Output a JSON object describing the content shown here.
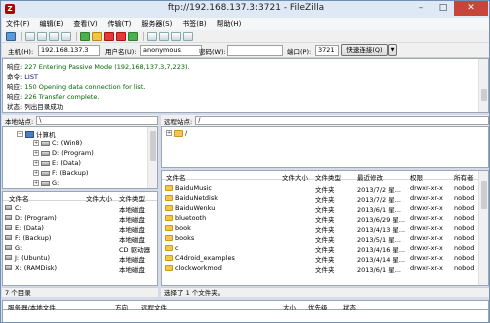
{
  "window": {
    "title": "ftp://192.168.137.3:3721 - FileZilla",
    "app_icon": "filezilla-icon",
    "controls": {
      "minimize": "–",
      "maximize": "□",
      "close": "✕"
    }
  },
  "menu": [
    "文件(F)",
    "编辑(E)",
    "查看(V)",
    "传输(T)",
    "服务器(S)",
    "书签(B)",
    "帮助(H)"
  ],
  "quickconnect": {
    "host_label": "主机(H):",
    "host_value": "192.168.137.3",
    "user_label": "用户名(U):",
    "user_value": "anonymous",
    "pass_label": "密码(W):",
    "pass_value": "",
    "port_label": "端口(P):",
    "port_value": "3721",
    "connect_label": "快速连接(Q)",
    "drop_icon": "▼"
  },
  "log": [
    {
      "key": "响应:",
      "text": "227 Entering Passive Mode (192,168,137,3,7,223).",
      "ok": true
    },
    {
      "key": "命令:",
      "text": "LIST",
      "ok": false
    },
    {
      "key": "响应:",
      "text": "150 Opening data connection for list.",
      "ok": true
    },
    {
      "key": "响应:",
      "text": "226 Transfer complete.",
      "ok": true
    },
    {
      "key": "状态:",
      "text": "列出目录成功",
      "ok": false
    }
  ],
  "local": {
    "site_label": "本地站点:",
    "site_value": "\\",
    "tree": [
      {
        "label": "计算机",
        "level": 0,
        "icon": "computer-icon",
        "expander": "−"
      },
      {
        "label": "C: (Win8)",
        "level": 1,
        "icon": "drive-icon",
        "expander": "+"
      },
      {
        "label": "D: (Program)",
        "level": 1,
        "icon": "drive-icon",
        "expander": "+"
      },
      {
        "label": "E: (Data)",
        "level": 1,
        "icon": "drive-icon",
        "expander": "+"
      },
      {
        "label": "F: (Backup)",
        "level": 1,
        "icon": "drive-icon",
        "expander": "+"
      },
      {
        "label": "G:",
        "level": 1,
        "icon": "drive-icon",
        "expander": "+"
      }
    ],
    "columns": [
      "文件名",
      "文件大小",
      "文件类型"
    ],
    "files": [
      {
        "name": "C:",
        "size": "",
        "type": "本地磁盘"
      },
      {
        "name": "D: (Program)",
        "size": "",
        "type": "本地磁盘"
      },
      {
        "name": "E: (Data)",
        "size": "",
        "type": "本地磁盘"
      },
      {
        "name": "F: (Backup)",
        "size": "",
        "type": "本地磁盘"
      },
      {
        "name": "G:",
        "size": "",
        "type": "CD 驱动器"
      },
      {
        "name": "J: (Ubuntu)",
        "size": "",
        "type": "本地磁盘"
      },
      {
        "name": "X: (RAMDisk)",
        "size": "",
        "type": "本地磁盘"
      }
    ],
    "status": "7 个目录"
  },
  "remote": {
    "site_label": "远程站点:",
    "site_value": "/",
    "tree": [
      {
        "label": "/",
        "level": 0,
        "icon": "folder-icon",
        "expander": "+"
      }
    ],
    "columns": [
      "文件名",
      "文件大小",
      "文件类型",
      "最近修改",
      "权限",
      "所有者"
    ],
    "files": [
      {
        "name": "BaiduMusic",
        "size": "",
        "type": "文件夹",
        "modified": "2013/7/2 星...",
        "perm": "drwxr-xr-x",
        "owner": "nobod"
      },
      {
        "name": "BaiduNetdisk",
        "size": "",
        "type": "文件夹",
        "modified": "2013/7/2 星...",
        "perm": "drwxr-xr-x",
        "owner": "nobod"
      },
      {
        "name": "BaiduWenku",
        "size": "",
        "type": "文件夹",
        "modified": "2013/6/1 星...",
        "perm": "drwxr-xr-x",
        "owner": "nobod"
      },
      {
        "name": "bluetooth",
        "size": "",
        "type": "文件夹",
        "modified": "2013/6/29 星...",
        "perm": "drwxr-xr-x",
        "owner": "nobod"
      },
      {
        "name": "book",
        "size": "",
        "type": "文件夹",
        "modified": "2013/4/13 星...",
        "perm": "drwxr-xr-x",
        "owner": "nobod"
      },
      {
        "name": "books",
        "size": "",
        "type": "文件夹",
        "modified": "2013/5/1 星...",
        "perm": "drwxr-xr-x",
        "owner": "nobod"
      },
      {
        "name": "c",
        "size": "",
        "type": "文件夹",
        "modified": "2013/4/16 星...",
        "perm": "drwxr-xr-x",
        "owner": "nobod"
      },
      {
        "name": "C4droid_examples",
        "size": "",
        "type": "文件夹",
        "modified": "2013/4/14 星...",
        "perm": "drwxr-xr-x",
        "owner": "nobod"
      },
      {
        "name": "clockworkmod",
        "size": "",
        "type": "文件夹",
        "modified": "2013/6/1 星...",
        "perm": "drwxr-xr-x",
        "owner": "nobod"
      }
    ],
    "status": "选择了 1 个文件夹。"
  },
  "queue": {
    "columns": [
      "服务器/本地文件",
      "方向",
      "远程文件",
      "大小",
      "优先级",
      "状态"
    ]
  }
}
